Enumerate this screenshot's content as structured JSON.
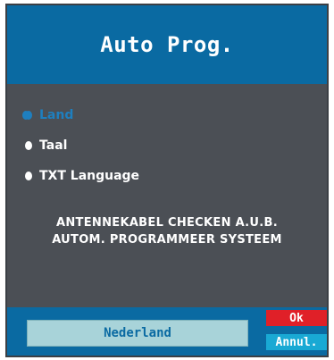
{
  "window": {
    "title": "Auto Prog."
  },
  "menu": {
    "items": [
      {
        "label": "Land",
        "state": "selected"
      },
      {
        "label": "Taal",
        "state": "normal"
      },
      {
        "label": "TXT Language",
        "state": "normal"
      }
    ]
  },
  "message": {
    "line1": "ANTENNEKABEL CHECKEN A.U.B.",
    "line2": "AUTOM. PROGRAMMEER SYSTEEM"
  },
  "footer": {
    "selected_value": "Nederland",
    "ok_label": "Ok",
    "cancel_label": "Annul."
  },
  "colors": {
    "header_bg": "#0a6aa2",
    "body_bg": "#4b4f55",
    "selected_item": "#1e7fbf",
    "value_box": "#a8d3d9",
    "ok_button": "#e02028",
    "cancel_button": "#19a9d4"
  }
}
